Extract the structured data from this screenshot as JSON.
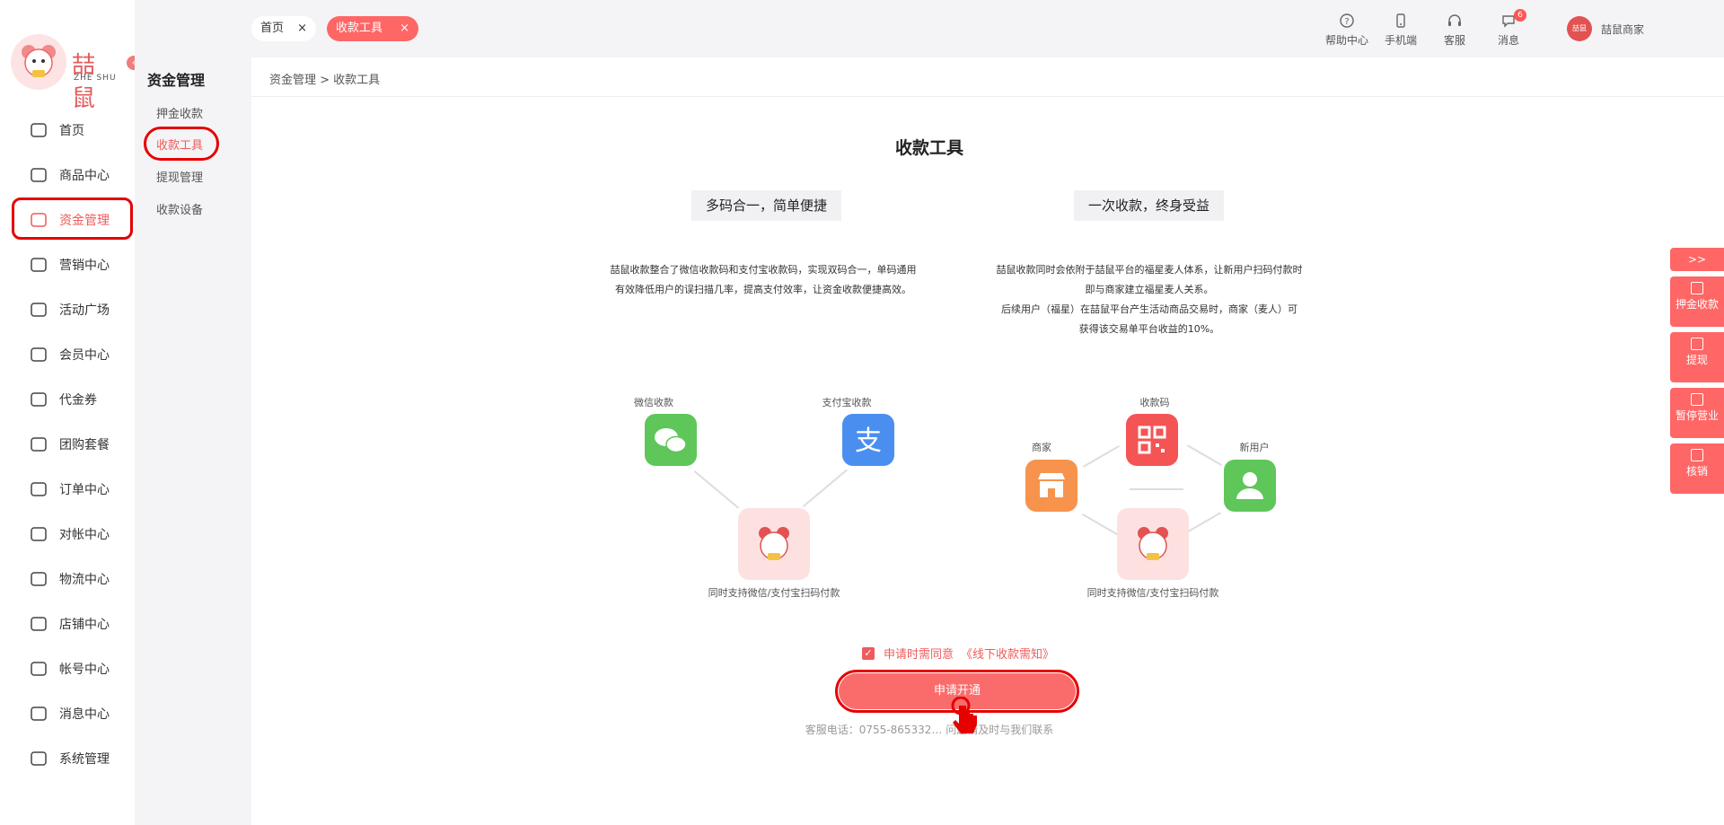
{
  "logo": {
    "brand": "喆鼠",
    "sub": "ZHE SHU"
  },
  "sidebar": {
    "items": [
      {
        "label": "首页",
        "icon": "home-icon"
      },
      {
        "label": "商品中心",
        "icon": "cart-icon"
      },
      {
        "label": "资金管理",
        "icon": "layers-icon"
      },
      {
        "label": "营销中心",
        "icon": "marketing-icon"
      },
      {
        "label": "活动广场",
        "icon": "box-icon"
      },
      {
        "label": "会员中心",
        "icon": "vip-icon"
      },
      {
        "label": "代金券",
        "icon": "coupon-icon"
      },
      {
        "label": "团购套餐",
        "icon": "tag-icon"
      },
      {
        "label": "订单中心",
        "icon": "order-icon"
      },
      {
        "label": "对帐中心",
        "icon": "yen-icon"
      },
      {
        "label": "物流中心",
        "icon": "package-icon"
      },
      {
        "label": "店铺中心",
        "icon": "store-icon"
      },
      {
        "label": "帐号中心",
        "icon": "user-icon"
      },
      {
        "label": "消息中心",
        "icon": "message-icon"
      },
      {
        "label": "系统管理",
        "icon": "settings-icon"
      }
    ],
    "active_index": 2
  },
  "subnav": {
    "title": "资金管理",
    "items": [
      "押金收款",
      "收款工具",
      "提现管理",
      "收款设备"
    ]
  },
  "tabs": {
    "home": "首页",
    "current": "收款工具",
    "close": "×"
  },
  "toolbar": {
    "help": "帮助中心",
    "mobile": "手机端",
    "service": "客服",
    "message": "消息",
    "message_badge": "6",
    "user_name": "喆鼠商家",
    "avatar_text": "喆鼠"
  },
  "breadcrumb": "资金管理 > 收款工具",
  "page": {
    "title": "收款工具",
    "feature_left": "多码合一，简单便捷",
    "feature_right": "一次收款，终身受益",
    "desc_left": [
      "喆鼠收款整合了微信收款码和支付宝收款码，实现双码合一，单码通用",
      "有效降低用户的误扫描几率，提高支付效率，让资金收款便捷高效。"
    ],
    "desc_right": [
      "喆鼠收款同时会依附于喆鼠平台的福星麦人体系，让新用户扫码付款时",
      "即与商家建立福星麦人关系。",
      "后续用户（福星）在喆鼠平台产生活动商品交易时，商家（麦人）可",
      "获得该交易单平台收益的10%。"
    ],
    "diagram_left": {
      "wechat": "微信收款",
      "alipay": "支付宝收款",
      "caption": "同时支持微信/支付宝扫码付款"
    },
    "diagram_right": {
      "code": "收款码",
      "merchant": "商家",
      "newuser": "新用户",
      "caption": "同时支持微信/支付宝扫码付款"
    },
    "agree_text": "申请时需同意",
    "agree_link": "《线下收款需知》",
    "apply_button": "申请开通",
    "service_line": "客服电话：0755-865332… 问题请及时与我们联系"
  },
  "float": {
    "toggle": ">>",
    "items": [
      "押金收款",
      "提现",
      "暂停营业",
      "核销"
    ]
  },
  "colors": {
    "accent": "#f66666",
    "highlight": "#e60000",
    "wechat": "#5fc65a",
    "alipay": "#4a8ff0"
  }
}
